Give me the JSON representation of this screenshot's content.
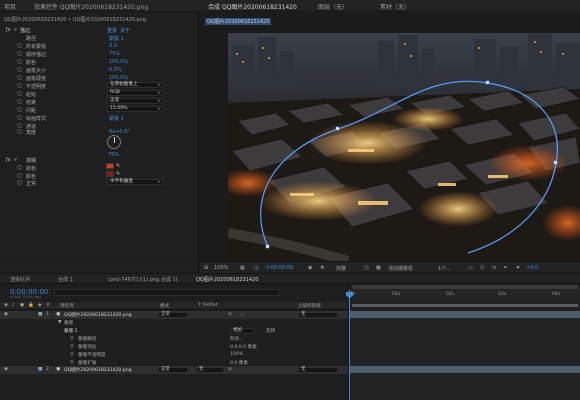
{
  "top_tabs": {
    "project": "项目",
    "effect_controls": "效果控件 QQ图片20200618231420.png",
    "composition": "合成 QQ图片20200618231420",
    "layer": "图层（无）",
    "footage": "素材（无）"
  },
  "effects": {
    "source": "QQ图片20200618231420 • QQ图片20200618231420.png",
    "effect_name": "描边",
    "reset_label": "重置",
    "about_label": "关于",
    "rows": [
      {
        "label": "路径",
        "value": "蒙版 1"
      },
      {
        "label": "所有蒙版",
        "value": ""
      },
      {
        "label": "顺序描边",
        "value": ""
      },
      {
        "label": "颜色",
        "value": ""
      },
      {
        "label": "画笔大小",
        "value": "3.0"
      },
      {
        "label": "画笔硬度",
        "value": "75%"
      },
      {
        "label": "不透明度",
        "value": "100.0%"
      },
      {
        "label": "起始",
        "value": "0.0%"
      },
      {
        "label": "结束",
        "value": "100.0%"
      },
      {
        "label": "间距",
        "value": "15.00%"
      },
      {
        "label": "绘画样式",
        "value": "在原始图像上"
      },
      {
        "label": "通道",
        "value": "RGB"
      },
      {
        "label": "角度",
        "value": "0x+0.0°"
      },
      {
        "label": "模糊",
        "value": ""
      },
      {
        "label": "",
        "value": ""
      }
    ],
    "color_a": "#c9401a",
    "color_b": "#8a1b12",
    "color_c": "#d06a22",
    "blend_label": "正常",
    "blend_value": "水平和垂直"
  },
  "viewer": {
    "comp_label": "QQ图片20200618231420",
    "zoom": "100%",
    "timecode": "0:00:00:00",
    "quality": "完整",
    "camera": "活动摄像机",
    "views": "1个...",
    "offset": "+0.0"
  },
  "timeline_tabs": {
    "render_queue": "渲染队列",
    "comp1": "合成 1",
    "comp2": "(pnd-7467(1)(1).png 合成 1)",
    "comp3": "QQ图片20200618231420"
  },
  "timeline": {
    "timecode": "0:00:00:00",
    "timecode_sub": "00000 (25.00 fps)",
    "search_placeholder": "",
    "col_source": "源名称",
    "col_mode": "模式",
    "col_trkmat": "T TrkMat",
    "col_parent": "父级和链接",
    "layer1_num": "1",
    "layer1_name": "QQ图片20200618231420.png",
    "layer1_mode": "正常",
    "layer1_parent": "无",
    "mask_label": "蒙版",
    "mask_row_label": "蒙版 1",
    "mask_add": "相加",
    "mask_invert": "反转",
    "mask_path": "蒙版路径",
    "mask_path_value": "形状...",
    "mask_feather": "蒙版羽化",
    "mask_feather_value": "0.0,0.0 像素",
    "mask_opacity": "蒙版不透明度",
    "mask_opacity_value": "100%",
    "mask_expansion": "蒙版扩展",
    "mask_expansion_value": "0.0 像素",
    "layer2_num": "2",
    "layer2_name": "QQ图片20200618231420.png",
    "layer2_mode": "正常",
    "layer2_trk": "无",
    "layer2_parent": "无",
    "ruler": [
      "0s",
      "01s",
      "02s",
      "03s",
      "04s"
    ]
  },
  "colors": {
    "accent": "#3d8fe0",
    "layer_bar": "#5a6b7a",
    "mask_bar": "#8a7a5a"
  }
}
